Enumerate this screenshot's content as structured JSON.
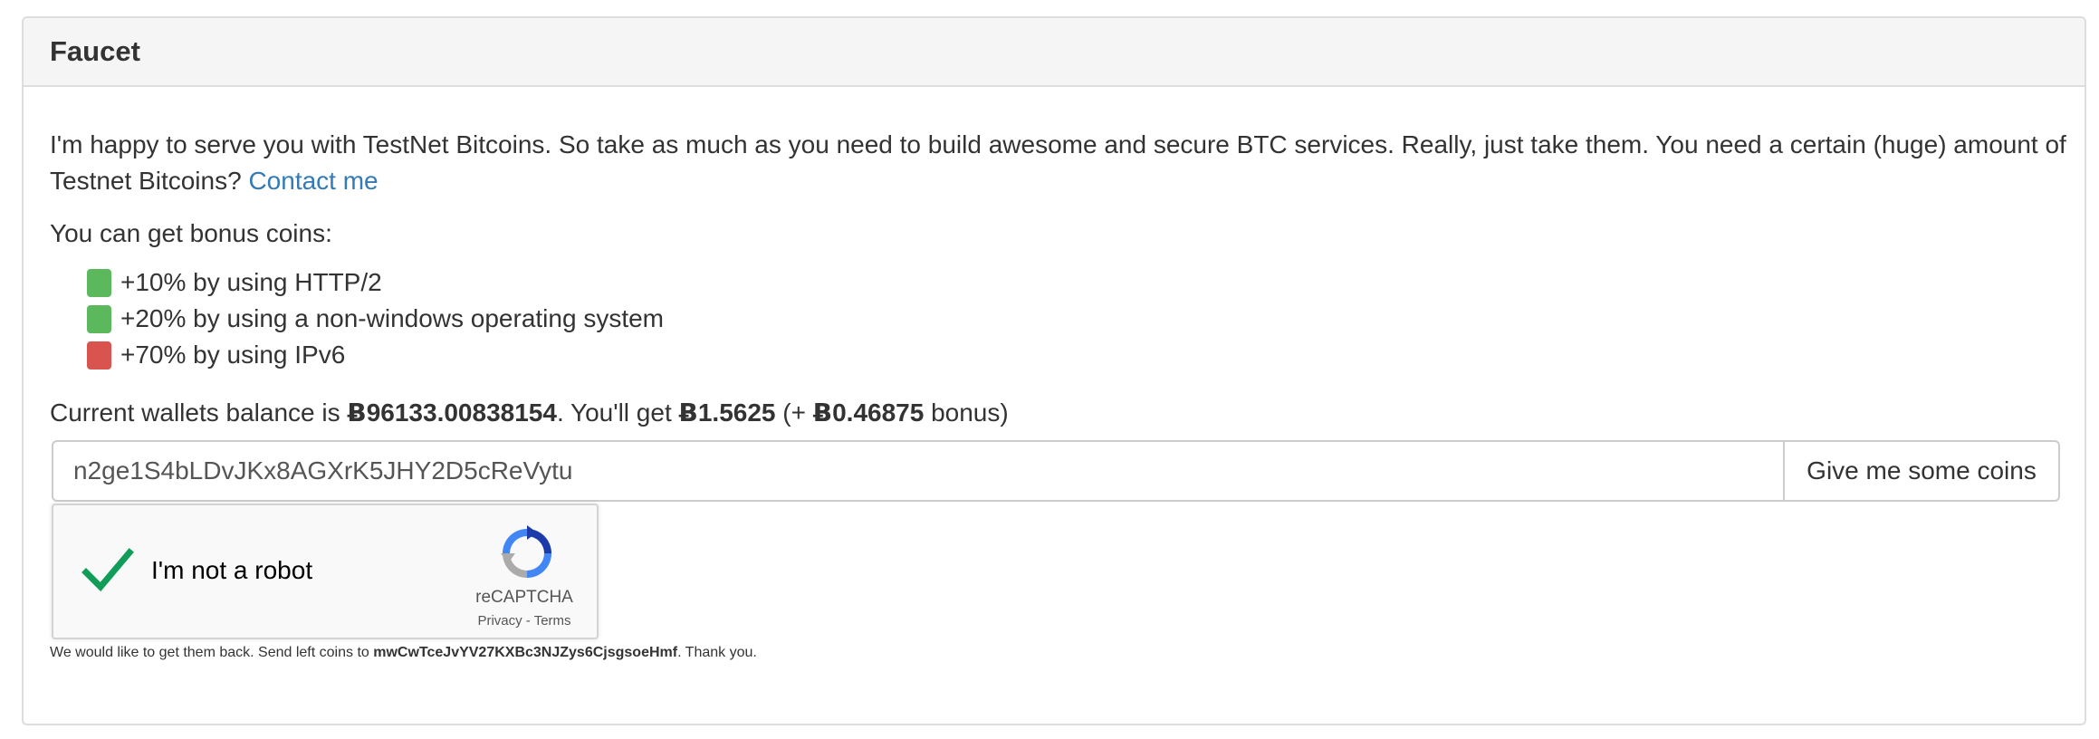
{
  "panel": {
    "title": "Faucet"
  },
  "intro": {
    "text": "I'm happy to serve you with TestNet Bitcoins. So take as much as you need to build awesome and secure BTC services. Really, just take them. You need a certain (huge) amount of Testnet Bitcoins?",
    "contact_link": "Contact me"
  },
  "bonus": {
    "heading": "You can get bonus coins:",
    "items": [
      {
        "label": "+10% by using HTTP/2",
        "status_color": "#5cb85c"
      },
      {
        "label": "+20% by using a non-windows operating system",
        "status_color": "#5cb85c"
      },
      {
        "label": "+70% by using IPv6",
        "status_color": "#d9534f"
      }
    ]
  },
  "balance": {
    "prefix": "Current wallets balance is",
    "currency_symbol": "Ƀ",
    "wallet_balance": "96133.00838154",
    "middle": ". You'll get",
    "amount": "1.5625",
    "bonus_open": "(+",
    "bonus_amount": "0.46875",
    "bonus_close": "bonus)"
  },
  "form": {
    "address_value": "n2ge1S4bLDvJKx8AGXrK5JHY2D5cReVytu",
    "submit_label": "Give me some coins"
  },
  "captcha": {
    "label": "I'm not a robot",
    "brand": "reCAPTCHA",
    "privacy": "Privacy",
    "separator": " - ",
    "terms": "Terms",
    "checked": true
  },
  "return": {
    "prefix": "We would like to get them back. Send left coins to",
    "address": "mwCwTceJvYV27KXBc3NJZys6CjsgsoeHmf",
    "suffix": ". Thank you."
  },
  "colors": {
    "link": "#337ab7",
    "check": "#0f9d58",
    "success": "#5cb85c",
    "danger": "#d9534f"
  }
}
